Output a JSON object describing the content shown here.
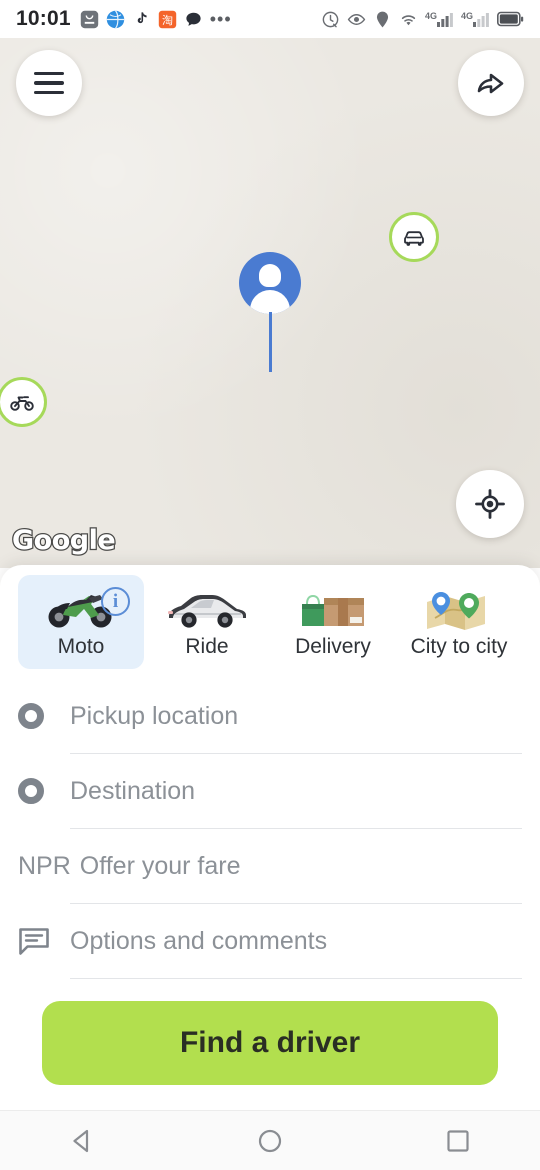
{
  "status_bar": {
    "time": "10:01",
    "left_icons": [
      "appgallery-icon",
      "browser-icon",
      "tiktok-icon",
      "taobao-icon",
      "chat-icon",
      "more-dots-icon"
    ],
    "right_icons": [
      "alarm-icon",
      "eye-care-icon",
      "location-icon",
      "wifi-icon",
      "signal-4g-one-icon",
      "signal-4g-two-icon",
      "battery-icon"
    ],
    "network_label_1": "4G",
    "network_label_2": "4G"
  },
  "map": {
    "menu_icon": "hamburger-menu-icon",
    "share_icon": "share-arrow-icon",
    "locate_icon": "my-location-icon",
    "attribution": "Google",
    "user_marker": "current-user-pin",
    "vehicles": [
      {
        "name": "nearby-car",
        "icon": "car-icon"
      },
      {
        "name": "nearby-moto",
        "icon": "motorcycle-icon"
      }
    ],
    "background_color": "#ebe8e2"
  },
  "sheet": {
    "tabs": [
      {
        "label": "Moto",
        "icon": "motorcycle-emoji",
        "selected": true,
        "info_badge": "i"
      },
      {
        "label": "Ride",
        "icon": "car-emoji",
        "selected": false
      },
      {
        "label": "Delivery",
        "icon": "package-emoji",
        "selected": false
      },
      {
        "label": "City to city",
        "icon": "map-emoji",
        "selected": false
      }
    ],
    "fields": {
      "pickup_placeholder": "Pickup location",
      "pickup_value": "",
      "destination_placeholder": "Destination",
      "destination_value": "",
      "fare_currency": "NPR",
      "fare_placeholder": "Offer your fare",
      "fare_value": "",
      "options_placeholder": "Options and comments",
      "options_value": "",
      "options_icon": "comment-bubble-icon"
    },
    "cta_label": "Find a driver",
    "cta_color": "#b2df4e"
  },
  "nav_bar": {
    "back": "back-triangle-icon",
    "home": "home-circle-icon",
    "recents": "recents-square-icon"
  }
}
